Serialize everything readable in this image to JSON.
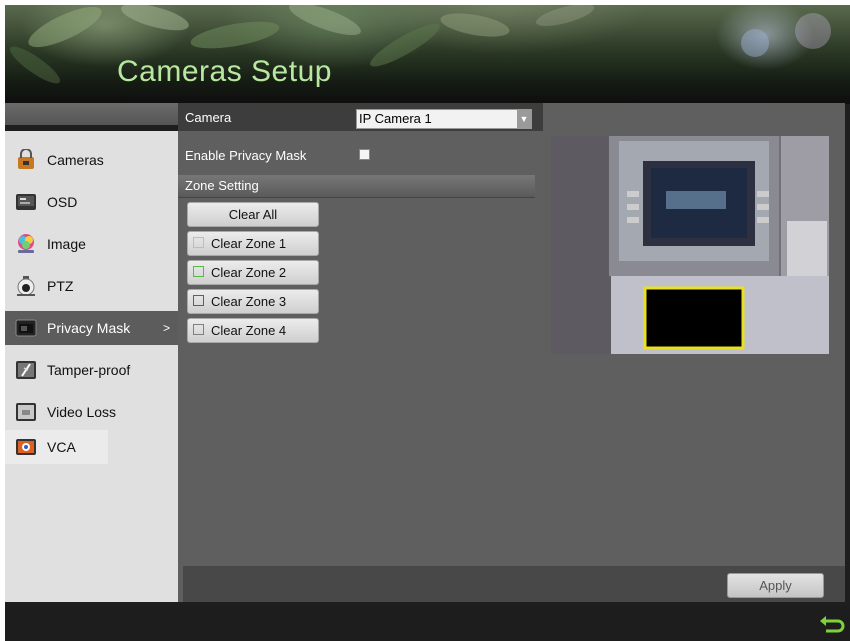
{
  "header": {
    "title": "Cameras Setup"
  },
  "sidebar": {
    "items": [
      {
        "label": "Cameras",
        "icon": "camera-lock-icon"
      },
      {
        "label": "OSD",
        "icon": "osd-icon"
      },
      {
        "label": "Image",
        "icon": "image-color-icon"
      },
      {
        "label": "PTZ",
        "icon": "ptz-dome-icon"
      },
      {
        "label": "Privacy Mask",
        "icon": "privacy-mask-icon",
        "active": true,
        "arrow": ">"
      },
      {
        "label": "Tamper-proof",
        "icon": "tamper-proof-icon"
      },
      {
        "label": "Video Loss",
        "icon": "video-loss-icon"
      },
      {
        "label": "VCA",
        "icon": "vca-icon"
      }
    ]
  },
  "main": {
    "camera_label": "Camera",
    "camera_value": "IP Camera 1",
    "enable_label": "Enable Privacy Mask",
    "enable_checked": false,
    "zone_setting_label": "Zone Setting",
    "clear_all_label": "Clear All",
    "zones": [
      {
        "label": "Clear Zone 1",
        "color": "#d8c840"
      },
      {
        "label": "Clear Zone 2",
        "color": "#58b848"
      },
      {
        "label": "Clear Zone 3",
        "color": "#3060d8"
      },
      {
        "label": "Clear Zone 4",
        "color": "#808080"
      }
    ],
    "apply_label": "Apply"
  },
  "colors": {
    "title": "#b8e8a0",
    "mask_outline": "#e8e020"
  },
  "footer": {
    "back_icon": "return-arrow-icon"
  }
}
